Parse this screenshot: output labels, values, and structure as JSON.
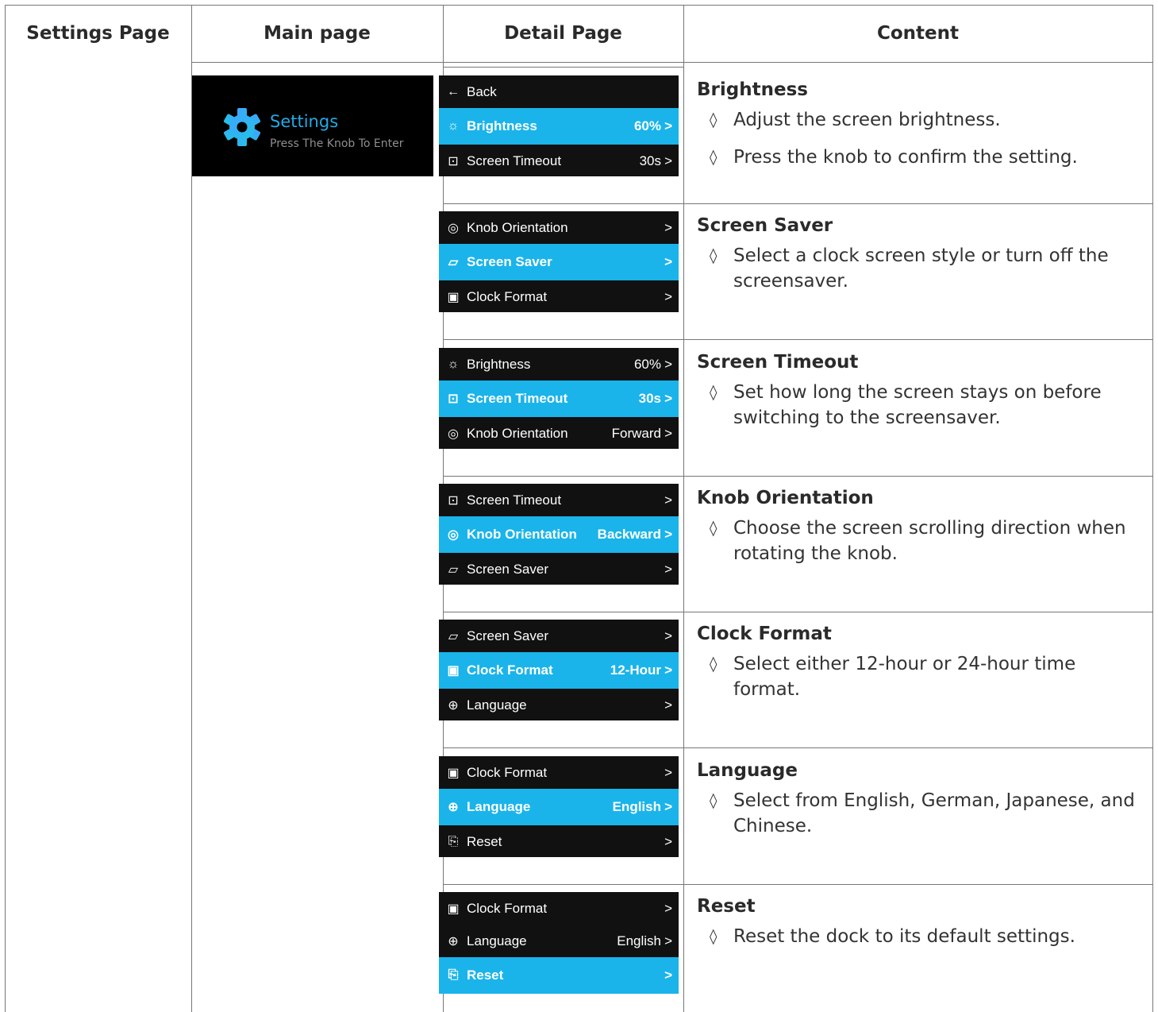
{
  "headers": [
    "Settings Page",
    "Main page",
    "Detail Page",
    "Content"
  ],
  "main_card": {
    "title": "Settings",
    "subtitle": "Press The Knob To Enter",
    "icon": "gear-icon"
  },
  "screens": [
    {
      "rows": [
        {
          "icon": "←",
          "label": "Back",
          "value": "",
          "chev": ""
        },
        {
          "icon": "☼",
          "label": "Brightness",
          "value": "60%",
          "chev": ">",
          "selected": true
        },
        {
          "icon": "⊡",
          "label": "Screen Timeout",
          "value": "30s",
          "chev": ">"
        }
      ]
    },
    {
      "rows": [
        {
          "icon": "◎",
          "label": "Knob Orientation",
          "value": "",
          "chev": ">"
        },
        {
          "icon": "▱",
          "label": "Screen Saver",
          "value": "",
          "chev": ">",
          "selected": true
        },
        {
          "icon": "▣",
          "label": "Clock Format",
          "value": "",
          "chev": ">"
        }
      ]
    },
    {
      "rows": [
        {
          "icon": "☼",
          "label": "Brightness",
          "value": "60%",
          "chev": ">"
        },
        {
          "icon": "⊡",
          "label": "Screen Timeout",
          "value": "30s",
          "chev": ">",
          "selected": true
        },
        {
          "icon": "◎",
          "label": "Knob Orientation",
          "value": "Forward",
          "chev": ">"
        }
      ]
    },
    {
      "rows": [
        {
          "icon": "⊡",
          "label": "Screen Timeout",
          "value": "",
          "chev": ">"
        },
        {
          "icon": "◎",
          "label": "Knob Orientation",
          "value": "Backward",
          "chev": ">",
          "selected": true
        },
        {
          "icon": "▱",
          "label": "Screen Saver",
          "value": "",
          "chev": ">"
        }
      ]
    },
    {
      "rows": [
        {
          "icon": "▱",
          "label": "Screen Saver",
          "value": "",
          "chev": ">"
        },
        {
          "icon": "▣",
          "label": "Clock Format",
          "value": "12-Hour",
          "chev": ">",
          "selected": true
        },
        {
          "icon": "⊕",
          "label": "Language",
          "value": "",
          "chev": ">"
        }
      ]
    },
    {
      "rows": [
        {
          "icon": "▣",
          "label": "Clock Format",
          "value": "",
          "chev": ">"
        },
        {
          "icon": "⊕",
          "label": "Language",
          "value": "English",
          "chev": ">",
          "selected": true
        },
        {
          "icon": "⎘",
          "label": "Reset",
          "value": "",
          "chev": ">"
        }
      ]
    },
    {
      "rows": [
        {
          "icon": "▣",
          "label": "Clock Format",
          "value": "",
          "chev": ">"
        },
        {
          "icon": "⊕",
          "label": "Language",
          "value": "English",
          "chev": ">"
        },
        {
          "icon": "⎘",
          "label": "Reset",
          "value": "",
          "chev": ">",
          "selected": true
        }
      ]
    }
  ],
  "content": [
    {
      "title": "Brightness",
      "lines": [
        "Adjust the screen brightness.",
        "Press the knob to confirm the setting."
      ]
    },
    {
      "title": "Screen Saver",
      "lines": [
        "Select a clock screen style or turn off the screensaver."
      ]
    },
    {
      "title": "Screen Timeout",
      "lines": [
        "Set how long the screen stays on before switching to the screensaver."
      ]
    },
    {
      "title": "Knob Orientation",
      "lines": [
        "Choose the screen scrolling direction when rotating the knob."
      ]
    },
    {
      "title": "Clock Format",
      "lines": [
        "Select either 12-hour or 24-hour time format."
      ]
    },
    {
      "title": "Language",
      "lines": [
        "Select from English, German, Japanese, and Chinese."
      ]
    },
    {
      "title": "Reset",
      "lines": [
        "Reset the dock to its default settings."
      ]
    }
  ],
  "colors": {
    "accent": "#1ab4ea",
    "screen_bg": "#111111",
    "title_blue": "#23a9e6"
  }
}
